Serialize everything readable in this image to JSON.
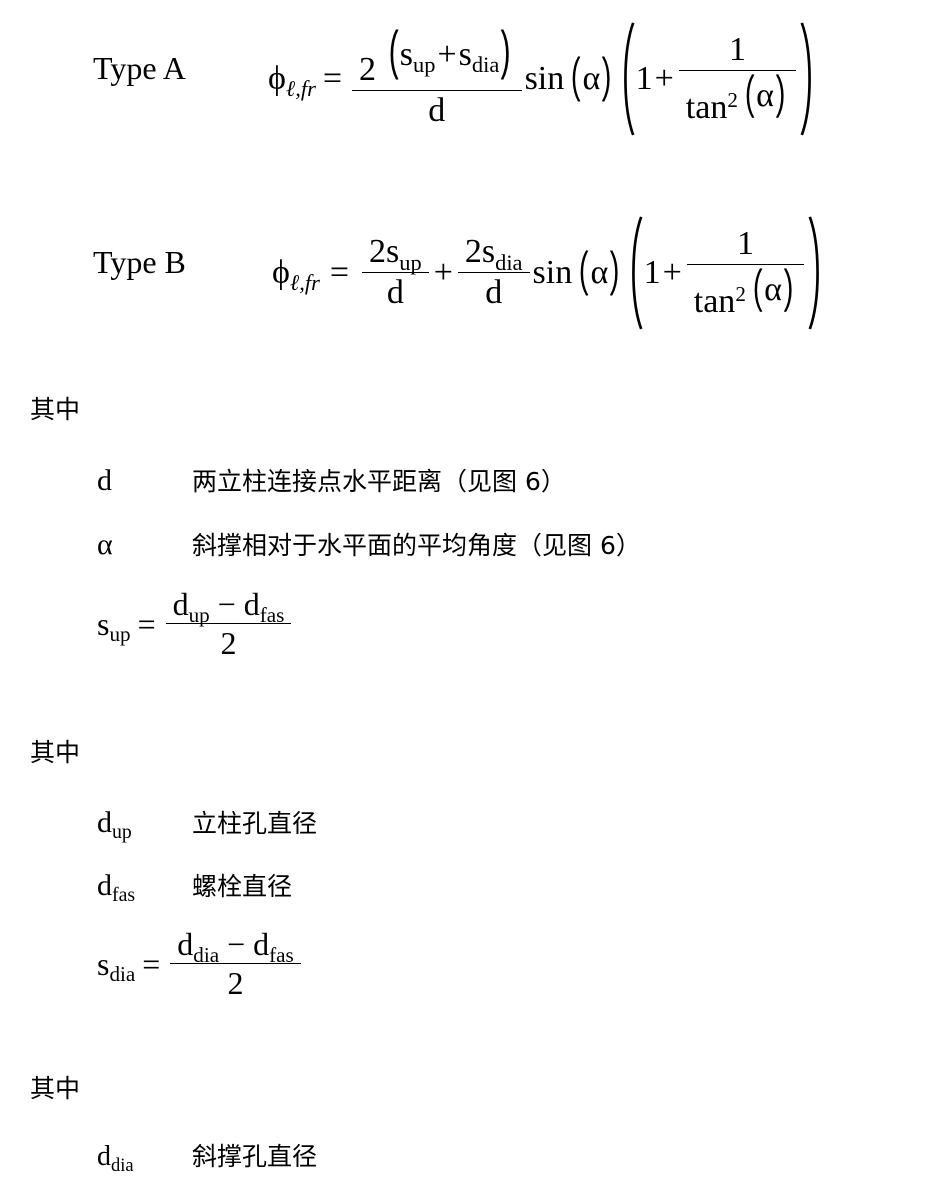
{
  "document": {
    "language": "zh-CN",
    "background_color": "#ffffff",
    "text_color": "#000000"
  },
  "equations": [
    {
      "id": "type-a",
      "label": "Type A",
      "lhs": {
        "symbol": "ϕ",
        "subscript": "ℓ,fr"
      },
      "relation": "=",
      "expression_text": "ϕℓ,fr = 2(s_up + s_dia)/d · sin(α) · (1 + 1/tan²(α))",
      "parts": {
        "frac_numerator_coefficient": "2",
        "frac_numerator_terms": [
          {
            "base": "s",
            "sub": "up"
          },
          {
            "base": "s",
            "sub": "dia"
          }
        ],
        "frac_numerator_operator": "+",
        "frac_denominator": "d",
        "trig": "sin",
        "trig_argument": "α",
        "bracket_first_term": "1",
        "bracket_operator": "+",
        "bracket_frac_numerator": "1",
        "bracket_frac_denominator_fn": "tan",
        "bracket_frac_denominator_power": "2",
        "bracket_frac_denominator_arg": "α"
      }
    },
    {
      "id": "type-b",
      "label": "Type B",
      "lhs": {
        "symbol": "ϕ",
        "subscript": "ℓ,fr"
      },
      "relation": "=",
      "expression_text": "ϕℓ,fr = 2s_up/d + 2s_dia/d · sin(α) · (1 + 1/tan²(α))",
      "parts": {
        "frac1_numerator_coefficient": "2",
        "frac1_numerator_term": {
          "base": "s",
          "sub": "up"
        },
        "frac1_denominator": "d",
        "joining_operator": "+",
        "frac2_numerator_coefficient": "2",
        "frac2_numerator_term": {
          "base": "s",
          "sub": "dia"
        },
        "frac2_denominator": "d",
        "trig": "sin",
        "trig_argument": "α",
        "bracket_first_term": "1",
        "bracket_operator": "+",
        "bracket_frac_numerator": "1",
        "bracket_frac_denominator_fn": "tan",
        "bracket_frac_denominator_power": "2",
        "bracket_frac_denominator_arg": "α"
      }
    }
  ],
  "sections": [
    {
      "id": "where-1",
      "heading": "其中",
      "definitions": [
        {
          "term_base": "d",
          "term_sub": "",
          "description": "两立柱连接点水平距离（见图 6）"
        },
        {
          "term_base": "α",
          "term_sub": "",
          "description": "斜撑相对于水平面的平均角度（见图 6）"
        }
      ],
      "formula": {
        "id": "s-up",
        "lhs_base": "s",
        "lhs_sub": "up",
        "relation": "=",
        "numerator_first_base": "d",
        "numerator_first_sub": "up",
        "numerator_operator": "−",
        "numerator_second_base": "d",
        "numerator_second_sub": "fas",
        "denominator": "2",
        "expression_text": "s_up = (d_up − d_fas) / 2"
      }
    },
    {
      "id": "where-2",
      "heading": "其中",
      "definitions": [
        {
          "term_base": "d",
          "term_sub": "up",
          "description": "立柱孔直径"
        },
        {
          "term_base": "d",
          "term_sub": "fas",
          "description": "螺栓直径"
        }
      ],
      "formula": {
        "id": "s-dia",
        "lhs_base": "s",
        "lhs_sub": "dia",
        "relation": "=",
        "numerator_first_base": "d",
        "numerator_first_sub": "dia",
        "numerator_operator": "−",
        "numerator_second_base": "d",
        "numerator_second_sub": "fas",
        "denominator": "2",
        "expression_text": "s_dia = (d_dia − d_fas) / 2"
      }
    },
    {
      "id": "where-3",
      "heading": "其中",
      "definitions": [
        {
          "term_base": "d",
          "term_sub": "dia",
          "description": "斜撑孔直径"
        }
      ],
      "formula": null
    }
  ]
}
